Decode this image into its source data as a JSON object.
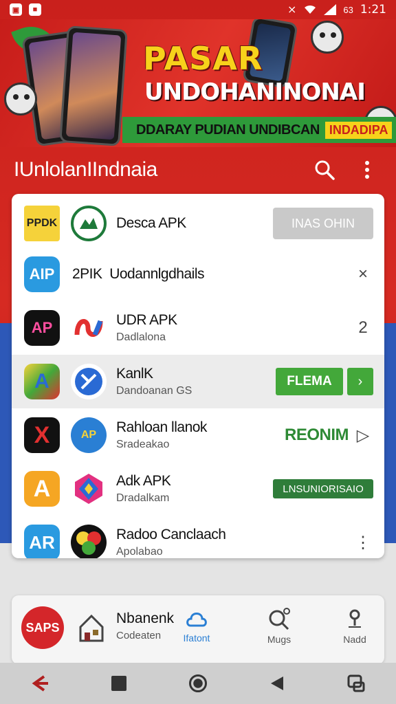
{
  "status_bar": {
    "time": "1:21",
    "battery": "63"
  },
  "banner": {
    "title": "PASAR",
    "subtitle": "UNDOHANINONAI",
    "strip_text": "DDARAY PUDIAN UNDIBCAN",
    "strip_badge": "INDADIPA"
  },
  "app_bar": {
    "title": "IUnlolanIIndnaia",
    "search_icon": "search-icon",
    "menu_icon": "more-vert-icon"
  },
  "apps": [
    {
      "icon1_text": "PPDK",
      "icon2_text": "",
      "title": "Desca APK",
      "subtitle": "",
      "action": "INAS OHIN",
      "action_type": "gray-button",
      "colors": [
        "#f5d23a",
        "#1e7a3a"
      ]
    },
    {
      "icon1_text": "AIP",
      "icon2_text": "2PIK",
      "title": "Uodannlgdhails",
      "subtitle": "",
      "action": "×",
      "action_type": "icon"
    },
    {
      "icon1_text": "AP",
      "icon2_text": "",
      "title": "UDR APK",
      "subtitle": "Dadlalona",
      "action": "2",
      "action_type": "icon"
    },
    {
      "icon1_text": "A",
      "icon2_text": "",
      "title": "KanlK",
      "subtitle": "Dandoanan GS",
      "action": "FLEMA",
      "action_type": "green-button",
      "action2": "›"
    },
    {
      "icon1_text": "X",
      "icon2_text": "AP",
      "title": "Rahloan llanok",
      "subtitle": "Sradeakao",
      "action": "REONIM",
      "action_type": "green-text",
      "action2": "▷"
    },
    {
      "icon1_text": "A",
      "icon2_text": "",
      "title": "Adk APK",
      "subtitle": "Dradalkam",
      "action": "LNSUNIORISAIO",
      "action_type": "darkgreen-button"
    },
    {
      "icon1_text": "AR",
      "icon2_text": "",
      "title": "Radoo Canclaach",
      "subtitle": "Apolabao",
      "action": "⋮",
      "action_type": "icon"
    }
  ],
  "bottom_card": {
    "logo_text": "SAPS",
    "title": "Nbanenk",
    "subtitle": "Codeaten",
    "nav": [
      {
        "label": "Ifatont",
        "icon": "cloud-icon",
        "active": true
      },
      {
        "label": "Mugs",
        "icon": "search-icon",
        "active": false
      },
      {
        "label": "Nadd",
        "icon": "location-icon",
        "active": false
      }
    ]
  },
  "accent_colors": {
    "red": "#c9201c",
    "green": "#43a83a",
    "blue": "#2d58b8"
  }
}
